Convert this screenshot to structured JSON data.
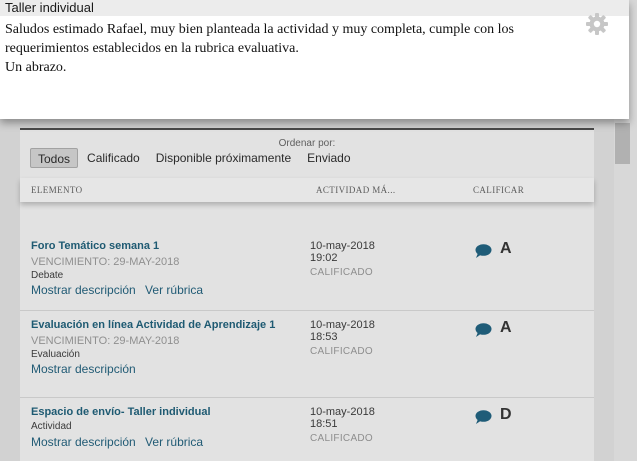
{
  "popup": {
    "title": "Taller individual",
    "comment_line1": "Saludos estimado Rafael, muy bien planteada la actividad y muy completa, cumple con los requerimientos establecidos en la rubrica evaluativa.",
    "comment_line2": "Un abrazo."
  },
  "grades": {
    "order_label": "Ordenar por:",
    "filters": [
      "Todos",
      "Calificado",
      "Disponible próximamente",
      "Enviado"
    ],
    "active_filter": "Todos",
    "columns": {
      "element": "ELEMENTO",
      "activity": "ACTIVIDAD MÁ...",
      "grade": "CALIFICAR"
    },
    "items": [
      {
        "title": "Foro Temático semana 1",
        "due": "VENCIMIENTO: 29-MAY-2018",
        "type": "Debate",
        "link_description": "Mostrar descripción",
        "link_rubric": "Ver rúbrica",
        "date": "10-may-2018",
        "time": "19:02",
        "status": "CALIFICADO",
        "grade": "A"
      },
      {
        "title": "Evaluación en línea Actividad de Aprendizaje 1",
        "due": "VENCIMIENTO: 29-MAY-2018",
        "type": "Evaluación",
        "link_description": "Mostrar descripción",
        "date": "10-may-2018",
        "time": "18:53",
        "status": "CALIFICADO",
        "grade": "A"
      },
      {
        "title": "Espacio de envío- Taller individual",
        "type": "Actividad",
        "link_description": "Mostrar descripción",
        "link_rubric": "Ver rúbrica",
        "date": "10-may-2018",
        "time": "18:51",
        "status": "CALIFICADO",
        "grade": "D"
      }
    ]
  },
  "icons": {
    "settings": "gear-icon",
    "comment": "comment-bubble-icon"
  },
  "colors": {
    "link": "#215b75",
    "title_link": "#1e5a72",
    "icon_gray": "#c7c7c7",
    "bubble": "#1f5c78"
  }
}
